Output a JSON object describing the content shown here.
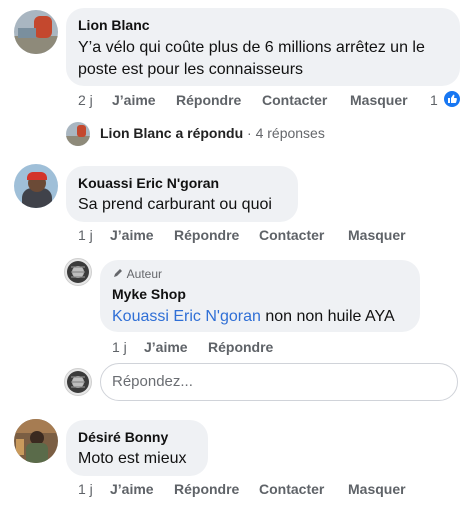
{
  "comments": [
    {
      "author": "Lion Blanc",
      "line1": "Y’a vélo qui coûte plus de 6 millions arrêtez un le",
      "line2": "poste est pour les connaisseurs",
      "time": "2 j",
      "like": "J’aime",
      "reply": "Répondre",
      "contact": "Contacter",
      "hide": "Masquer",
      "like_count": "1",
      "replies_summary_author": "Lion Blanc",
      "replies_summary_action": "a répondu",
      "replies_summary_sep": " · ",
      "replies_summary_count": "4 réponses"
    },
    {
      "author": "Kouassi Eric N'goran",
      "text": "Sa prend carburant ou quoi",
      "time": "1 j",
      "like": "J’aime",
      "reply": "Répondre",
      "contact": "Contacter",
      "hide": "Masquer"
    },
    {
      "author": "Désiré Bonny",
      "text": "Moto est mieux",
      "time": "1 j",
      "like": "J’aime",
      "reply": "Répondre",
      "contact": "Contacter",
      "hide": "Masquer"
    }
  ],
  "reply": {
    "badge": "Auteur",
    "author": "Myke Shop",
    "mention": "Kouassi Eric N'goran",
    "text": " non non huile AYA",
    "time": "1 j",
    "like": "J’aime",
    "reply": "Répondre"
  },
  "composer": {
    "placeholder": "Répondez..."
  },
  "colors": {
    "bubble_bg": "#eff1f4",
    "mention": "#2f6fd6",
    "action_text": "#5f6368",
    "like_blue": "#1877f2"
  }
}
